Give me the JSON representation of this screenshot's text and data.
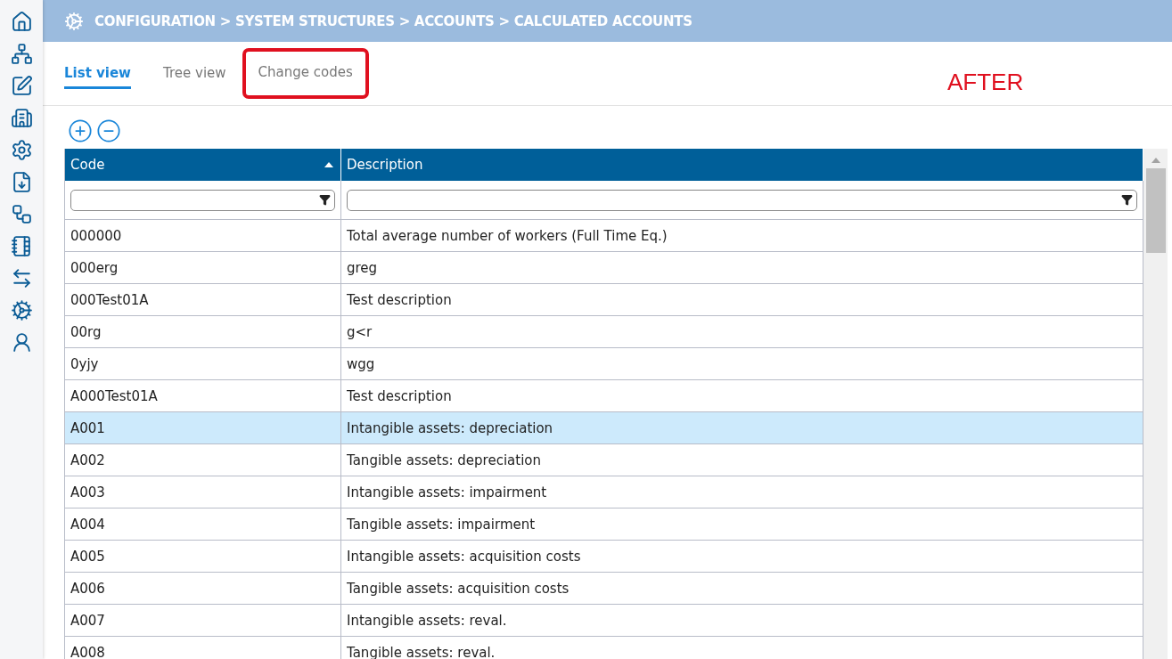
{
  "breadcrumb": "CONFIGURATION > SYSTEM STRUCTURES > ACCOUNTS > CALCULATED ACCOUNTS",
  "tabs": [
    {
      "label": "List view",
      "selected": true,
      "highlighted": false
    },
    {
      "label": "Tree view",
      "selected": false,
      "highlighted": false
    },
    {
      "label": "Change codes",
      "selected": false,
      "highlighted": true
    }
  ],
  "annotation": "AFTER",
  "table": {
    "columns": [
      {
        "label": "Code",
        "sorted": true
      },
      {
        "label": "Description",
        "sorted": false
      }
    ],
    "rows": [
      {
        "code": "000000",
        "description": "Total average number of workers (Full Time Eq.)",
        "selected": false
      },
      {
        "code": "000erg",
        "description": "greg",
        "selected": false
      },
      {
        "code": "000Test01A",
        "description": "Test description",
        "selected": false
      },
      {
        "code": "00rg",
        "description": "g<r",
        "selected": false
      },
      {
        "code": "0yjy",
        "description": "wgg",
        "selected": false
      },
      {
        "code": "A000Test01A",
        "description": "Test description",
        "selected": false
      },
      {
        "code": "A001",
        "description": "Intangible assets: depreciation",
        "selected": true
      },
      {
        "code": "A002",
        "description": "Tangible assets: depreciation",
        "selected": false
      },
      {
        "code": "A003",
        "description": "Intangible assets: impairment",
        "selected": false
      },
      {
        "code": "A004",
        "description": "Tangible assets: impairment",
        "selected": false
      },
      {
        "code": "A005",
        "description": "Intangible assets: acquisition costs",
        "selected": false
      },
      {
        "code": "A006",
        "description": "Tangible assets: acquisition costs",
        "selected": false
      },
      {
        "code": "A007",
        "description": "Intangible assets: reval.",
        "selected": false
      },
      {
        "code": "A008",
        "description": "Tangible assets: reval.",
        "selected": false
      }
    ]
  }
}
